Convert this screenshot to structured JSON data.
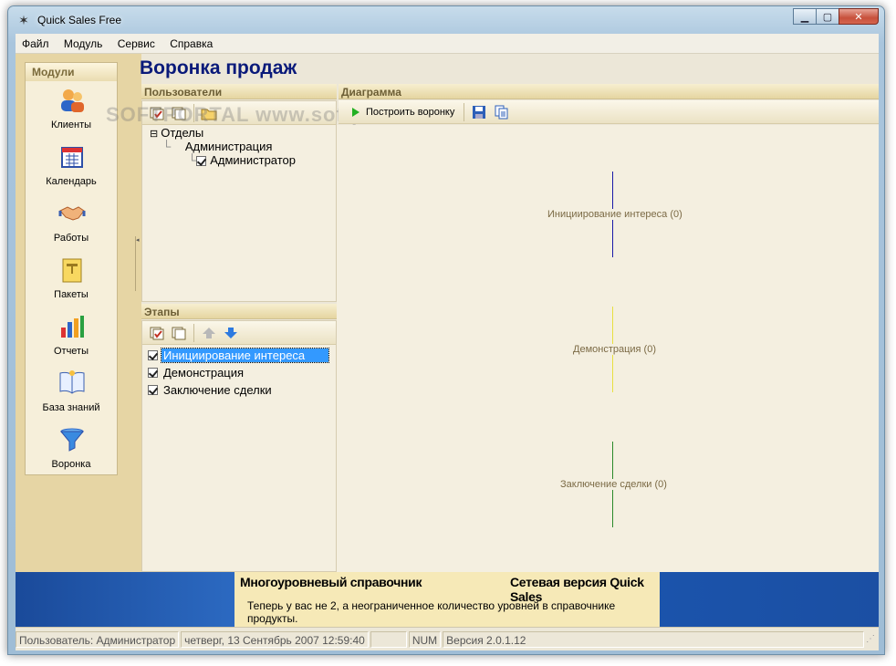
{
  "window": {
    "title": "Quick Sales Free"
  },
  "menu": [
    "Файл",
    "Модуль",
    "Сервис",
    "Справка"
  ],
  "sidebar": {
    "header": "Модули",
    "items": [
      {
        "label": "Клиенты",
        "icon": "clients-icon"
      },
      {
        "label": "Календарь",
        "icon": "calendar-icon"
      },
      {
        "label": "Работы",
        "icon": "handshake-icon"
      },
      {
        "label": "Пакеты",
        "icon": "package-icon"
      },
      {
        "label": "Отчеты",
        "icon": "chart-icon"
      },
      {
        "label": "База знаний",
        "icon": "book-icon"
      },
      {
        "label": "Воронка",
        "icon": "funnel-icon"
      }
    ]
  },
  "page": {
    "title": "Воронка продаж"
  },
  "users_panel": {
    "header": "Пользователи",
    "tree": {
      "root": "Отделы",
      "group": "Администрация",
      "user": "Администратор"
    }
  },
  "stages_panel": {
    "header": "Этапы",
    "items": [
      {
        "label": "Инициирование интереса",
        "checked": true,
        "selected": true
      },
      {
        "label": "Демонстрация",
        "checked": true,
        "selected": false
      },
      {
        "label": "Заключение сделки",
        "checked": true,
        "selected": false
      }
    ]
  },
  "diagram_panel": {
    "header": "Диаграмма",
    "build_button": "Построить воронку",
    "stages": [
      {
        "label": "Инициирование интереса (0)",
        "color": "#1a1aa8"
      },
      {
        "label": "Демонстрация (0)",
        "color": "#e8e040"
      },
      {
        "label": "Заключение сделки (0)",
        "color": "#2a8a2a"
      }
    ]
  },
  "banner": {
    "title_left": "Многоуровневый справочник",
    "title_right": "Сетевая версия Quick Sales",
    "text": "Теперь у вас не 2,  а неограниченное количество уровней в справочнике продукты."
  },
  "status": {
    "user": "Пользователь: Администратор",
    "datetime": "четверг, 13 Сентябрь 2007 12:59:40",
    "empty": "",
    "num": "NUM",
    "version": "Версия 2.0.1.12"
  },
  "watermark": "SOFTPORTAL www.softportal.com"
}
